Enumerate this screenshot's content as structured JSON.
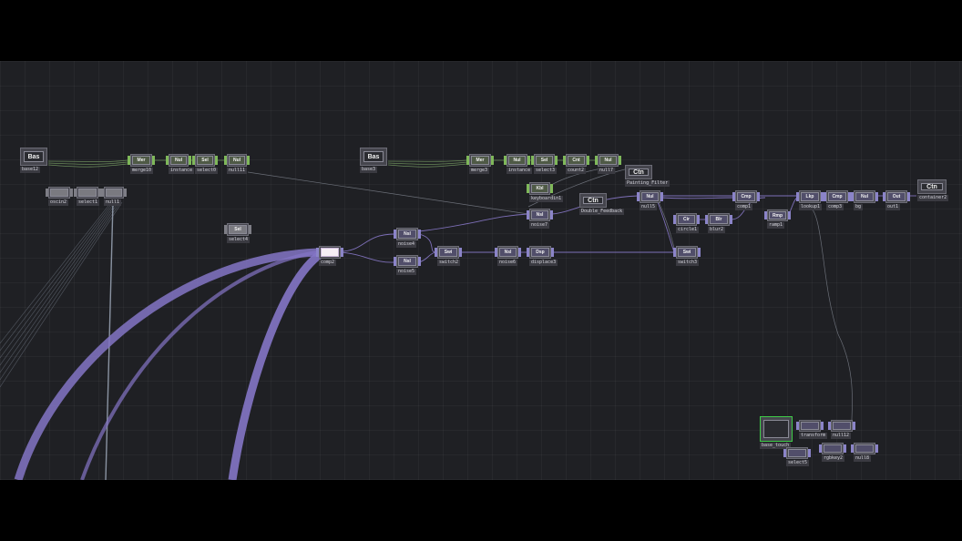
{
  "app": {
    "view": "TouchDesigner network editor"
  },
  "colors": {
    "background": "#1f2024",
    "wire_data": "#6a8a5a",
    "wire_top": "#8878c8",
    "selected": "#3fcc48"
  },
  "nodes": {
    "base12": {
      "tag": "Bas",
      "label": "base12"
    },
    "merge10": {
      "tag": "Mer",
      "label": "merge10"
    },
    "instance": {
      "tag": "Nul",
      "label": "instance"
    },
    "select0": {
      "tag": "Sel",
      "label": "select0"
    },
    "null11": {
      "tag": "Nul",
      "label": "null11"
    },
    "oscin2": {
      "tag": "",
      "label": "oscin2"
    },
    "select1": {
      "tag": "",
      "label": "select1"
    },
    "null1": {
      "tag": "",
      "label": "null1"
    },
    "select4": {
      "tag": "Sel",
      "label": "select4"
    },
    "base3": {
      "tag": "Bas",
      "label": "base3"
    },
    "merge3": {
      "tag": "Mer",
      "label": "merge3"
    },
    "instance2": {
      "tag": "Nul",
      "label": "instance"
    },
    "select3": {
      "tag": "Sel",
      "label": "select3"
    },
    "count2": {
      "tag": "Cnt",
      "label": "count2"
    },
    "null7": {
      "tag": "Nul",
      "label": "null7"
    },
    "painting_filter": {
      "tag": "Ctn",
      "label": "Painting_Filter"
    },
    "keyboardin1": {
      "tag": "Kbl",
      "label": "keyboardin1"
    },
    "noise7": {
      "tag": "Nsl",
      "label": "noise7"
    },
    "double_feedback": {
      "tag": "Ctn",
      "label": "Double_Feedback"
    },
    "null5": {
      "tag": "Nul",
      "label": "null5"
    },
    "comp1": {
      "tag": "Cmp",
      "label": "comp1"
    },
    "circle1": {
      "tag": "Cir",
      "label": "circle1"
    },
    "blur2": {
      "tag": "Blr",
      "label": "blur2"
    },
    "ramp1": {
      "tag": "Rmp",
      "label": "ramp1"
    },
    "lookup1": {
      "tag": "Lkp",
      "label": "lookup1"
    },
    "comp3": {
      "tag": "Cmp",
      "label": "comp3"
    },
    "bg": {
      "tag": "Nul",
      "label": "bg"
    },
    "out1": {
      "tag": "Out",
      "label": "out1"
    },
    "container2": {
      "tag": "Ctn",
      "label": "container2"
    },
    "noise4": {
      "tag": "Nsl",
      "label": "noise4"
    },
    "noise5": {
      "tag": "Nsl",
      "label": "noise5"
    },
    "comp2": {
      "tag": "",
      "label": "comp2"
    },
    "switch2": {
      "tag": "Swi",
      "label": "switch2"
    },
    "noise6": {
      "tag": "Nsl",
      "label": "noise6"
    },
    "displace3": {
      "tag": "Dsp",
      "label": "displace3"
    },
    "switch3": {
      "tag": "Swi",
      "label": "switch3"
    },
    "base_touch": {
      "tag": "",
      "label": "base_touch"
    },
    "transform": {
      "tag": "",
      "label": "transform"
    },
    "null12": {
      "tag": "",
      "label": "null12"
    },
    "select5": {
      "tag": "",
      "label": "select5"
    },
    "rgbkey2": {
      "tag": "",
      "label": "rgbkey2"
    },
    "null8": {
      "tag": "",
      "label": "null8"
    }
  }
}
